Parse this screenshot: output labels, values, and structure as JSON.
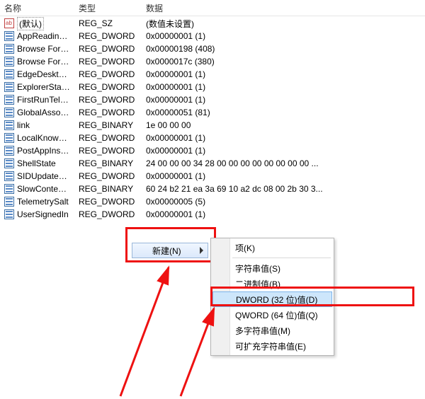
{
  "columns": {
    "name": "名称",
    "type": "类型",
    "data": "数据"
  },
  "rows": [
    {
      "icon": "sz",
      "name": "(默认)",
      "type": "REG_SZ",
      "data": "(数值未设置)",
      "selected": true
    },
    {
      "icon": "bin",
      "name": "AppReadiness...",
      "type": "REG_DWORD",
      "data": "0x00000001 (1)"
    },
    {
      "icon": "bin",
      "name": "Browse For Fol...",
      "type": "REG_DWORD",
      "data": "0x00000198 (408)"
    },
    {
      "icon": "bin",
      "name": "Browse For Fol...",
      "type": "REG_DWORD",
      "data": "0x0000017c (380)"
    },
    {
      "icon": "bin",
      "name": "EdgeDesktopS...",
      "type": "REG_DWORD",
      "data": "0x00000001 (1)"
    },
    {
      "icon": "bin",
      "name": "ExplorerStartu...",
      "type": "REG_DWORD",
      "data": "0x00000001 (1)"
    },
    {
      "icon": "bin",
      "name": "FirstRunTelem...",
      "type": "REG_DWORD",
      "data": "0x00000001 (1)"
    },
    {
      "icon": "bin",
      "name": "GlobalAssocCh...",
      "type": "REG_DWORD",
      "data": "0x00000051 (81)"
    },
    {
      "icon": "bin",
      "name": "link",
      "type": "REG_BINARY",
      "data": "1e 00 00 00"
    },
    {
      "icon": "bin",
      "name": "LocalKnownFol...",
      "type": "REG_DWORD",
      "data": "0x00000001 (1)"
    },
    {
      "icon": "bin",
      "name": "PostAppInstall...",
      "type": "REG_DWORD",
      "data": "0x00000001 (1)"
    },
    {
      "icon": "bin",
      "name": "ShellState",
      "type": "REG_BINARY",
      "data": "24 00 00 00 34 28 00 00 00 00 00 00 00 00 ..."
    },
    {
      "icon": "bin",
      "name": "SIDUpdatedO...",
      "type": "REG_DWORD",
      "data": "0x00000001 (1)"
    },
    {
      "icon": "bin",
      "name": "SlowContextM...",
      "type": "REG_BINARY",
      "data": "60 24 b2 21 ea 3a 69 10 a2 dc 08 00 2b 30 3..."
    },
    {
      "icon": "bin",
      "name": "TelemetrySalt",
      "type": "REG_DWORD",
      "data": "0x00000005 (5)"
    },
    {
      "icon": "bin",
      "name": "UserSignedIn",
      "type": "REG_DWORD",
      "data": "0x00000001 (1)"
    }
  ],
  "menu1": {
    "new": "新建(N)"
  },
  "menu2": {
    "key": "项(K)",
    "string": "字符串值(S)",
    "binary": "二进制值(B)",
    "dword": "DWORD (32 位)值(D)",
    "qword": "QWORD (64 位)值(Q)",
    "multi": "多字符串值(M)",
    "expand": "可扩充字符串值(E)"
  }
}
